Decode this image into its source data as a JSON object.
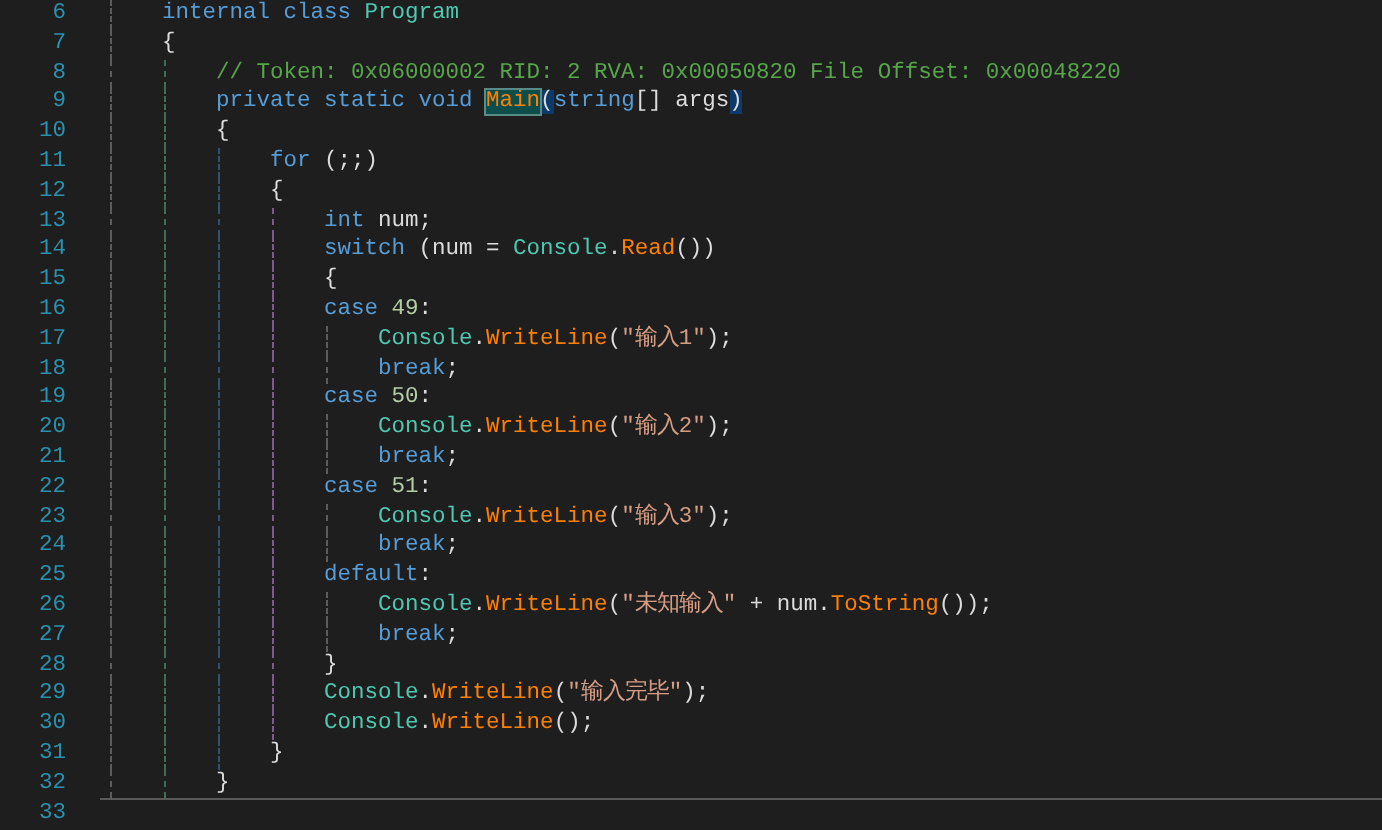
{
  "lines": [
    {
      "number": "6",
      "tokens": [
        {
          "t": "    internal class ",
          "kind": "keyword"
        },
        {
          "t": "Program",
          "kind": "type"
        }
      ]
    },
    {
      "number": "7",
      "tokens": [
        {
          "t": "    {",
          "kind": "plain"
        }
      ]
    },
    {
      "number": "8",
      "tokens": [
        {
          "t": "        // Token: 0x06000002 RID: 2 RVA: 0x00050820 File Offset: 0x00048220",
          "kind": "comment"
        }
      ]
    },
    {
      "number": "9",
      "tokens": [
        {
          "t": "        private static void ",
          "kind": "keyword"
        },
        {
          "t": "Main",
          "kind": "method",
          "highlighted": true
        },
        {
          "t": "(",
          "kind": "plain",
          "highlighted": true
        },
        {
          "t": "string",
          "kind": "keyword"
        },
        {
          "t": "[] args",
          "kind": "plain"
        },
        {
          "t": ")",
          "kind": "plain",
          "highlighted": true
        }
      ]
    },
    {
      "number": "10",
      "tokens": [
        {
          "t": "        {",
          "kind": "plain"
        }
      ]
    },
    {
      "number": "11",
      "tokens": [
        {
          "t": "            for",
          "kind": "keyword"
        },
        {
          "t": " (;;)",
          "kind": "plain"
        }
      ]
    },
    {
      "number": "12",
      "tokens": [
        {
          "t": "            {",
          "kind": "plain"
        }
      ]
    },
    {
      "number": "13",
      "tokens": [
        {
          "t": "                int",
          "kind": "keyword"
        },
        {
          "t": " num;",
          "kind": "plain"
        }
      ]
    },
    {
      "number": "14",
      "tokens": [
        {
          "t": "                switch",
          "kind": "keyword"
        },
        {
          "t": " (num = ",
          "kind": "plain"
        },
        {
          "t": "Console",
          "kind": "type"
        },
        {
          "t": ".",
          "kind": "plain"
        },
        {
          "t": "Read",
          "kind": "method"
        },
        {
          "t": "())",
          "kind": "plain"
        }
      ]
    },
    {
      "number": "15",
      "tokens": [
        {
          "t": "                {",
          "kind": "plain"
        }
      ]
    },
    {
      "number": "16",
      "tokens": [
        {
          "t": "                case",
          "kind": "keyword"
        },
        {
          "t": " 49",
          "kind": "number"
        },
        {
          "t": ":",
          "kind": "plain"
        }
      ]
    },
    {
      "number": "17",
      "tokens": [
        {
          "t": "                    Console",
          "kind": "type"
        },
        {
          "t": ".",
          "kind": "plain"
        },
        {
          "t": "WriteLine",
          "kind": "method"
        },
        {
          "t": "(",
          "kind": "plain"
        },
        {
          "t": "\"输入1\"",
          "kind": "string"
        },
        {
          "t": ");",
          "kind": "plain"
        }
      ]
    },
    {
      "number": "18",
      "tokens": [
        {
          "t": "                    break",
          "kind": "keyword"
        },
        {
          "t": ";",
          "kind": "plain"
        }
      ]
    },
    {
      "number": "19",
      "tokens": [
        {
          "t": "                case",
          "kind": "keyword"
        },
        {
          "t": " 50",
          "kind": "number"
        },
        {
          "t": ":",
          "kind": "plain"
        }
      ]
    },
    {
      "number": "20",
      "tokens": [
        {
          "t": "                    Console",
          "kind": "type"
        },
        {
          "t": ".",
          "kind": "plain"
        },
        {
          "t": "WriteLine",
          "kind": "method"
        },
        {
          "t": "(",
          "kind": "plain"
        },
        {
          "t": "\"输入2\"",
          "kind": "string"
        },
        {
          "t": ");",
          "kind": "plain"
        }
      ]
    },
    {
      "number": "21",
      "tokens": [
        {
          "t": "                    break",
          "kind": "keyword"
        },
        {
          "t": ";",
          "kind": "plain"
        }
      ]
    },
    {
      "number": "22",
      "tokens": [
        {
          "t": "                case",
          "kind": "keyword"
        },
        {
          "t": " 51",
          "kind": "number"
        },
        {
          "t": ":",
          "kind": "plain"
        }
      ]
    },
    {
      "number": "23",
      "tokens": [
        {
          "t": "                    Console",
          "kind": "type"
        },
        {
          "t": ".",
          "kind": "plain"
        },
        {
          "t": "WriteLine",
          "kind": "method"
        },
        {
          "t": "(",
          "kind": "plain"
        },
        {
          "t": "\"输入3\"",
          "kind": "string"
        },
        {
          "t": ");",
          "kind": "plain"
        }
      ]
    },
    {
      "number": "24",
      "tokens": [
        {
          "t": "                    break",
          "kind": "keyword"
        },
        {
          "t": ";",
          "kind": "plain"
        }
      ]
    },
    {
      "number": "25",
      "tokens": [
        {
          "t": "                default",
          "kind": "keyword"
        },
        {
          "t": ":",
          "kind": "plain"
        }
      ]
    },
    {
      "number": "26",
      "tokens": [
        {
          "t": "                    Console",
          "kind": "type"
        },
        {
          "t": ".",
          "kind": "plain"
        },
        {
          "t": "WriteLine",
          "kind": "method"
        },
        {
          "t": "(",
          "kind": "plain"
        },
        {
          "t": "\"未知输入\"",
          "kind": "string"
        },
        {
          "t": " + num.",
          "kind": "plain"
        },
        {
          "t": "ToString",
          "kind": "method"
        },
        {
          "t": "());",
          "kind": "plain"
        }
      ]
    },
    {
      "number": "27",
      "tokens": [
        {
          "t": "                    break",
          "kind": "keyword"
        },
        {
          "t": ";",
          "kind": "plain"
        }
      ]
    },
    {
      "number": "28",
      "tokens": [
        {
          "t": "                }",
          "kind": "plain"
        }
      ]
    },
    {
      "number": "29",
      "tokens": [
        {
          "t": "                Console",
          "kind": "type"
        },
        {
          "t": ".",
          "kind": "plain"
        },
        {
          "t": "WriteLine",
          "kind": "method"
        },
        {
          "t": "(",
          "kind": "plain"
        },
        {
          "t": "\"输入完毕\"",
          "kind": "string"
        },
        {
          "t": ");",
          "kind": "plain"
        }
      ]
    },
    {
      "number": "30",
      "tokens": [
        {
          "t": "                Console",
          "kind": "type"
        },
        {
          "t": ".",
          "kind": "plain"
        },
        {
          "t": "WriteLine",
          "kind": "method"
        },
        {
          "t": "();",
          "kind": "plain"
        }
      ]
    },
    {
      "number": "31",
      "tokens": [
        {
          "t": "            }",
          "kind": "plain"
        }
      ]
    },
    {
      "number": "32",
      "tokens": [
        {
          "t": "        }",
          "kind": "plain"
        }
      ],
      "separator": true
    },
    {
      "number": "33"
    }
  ]
}
